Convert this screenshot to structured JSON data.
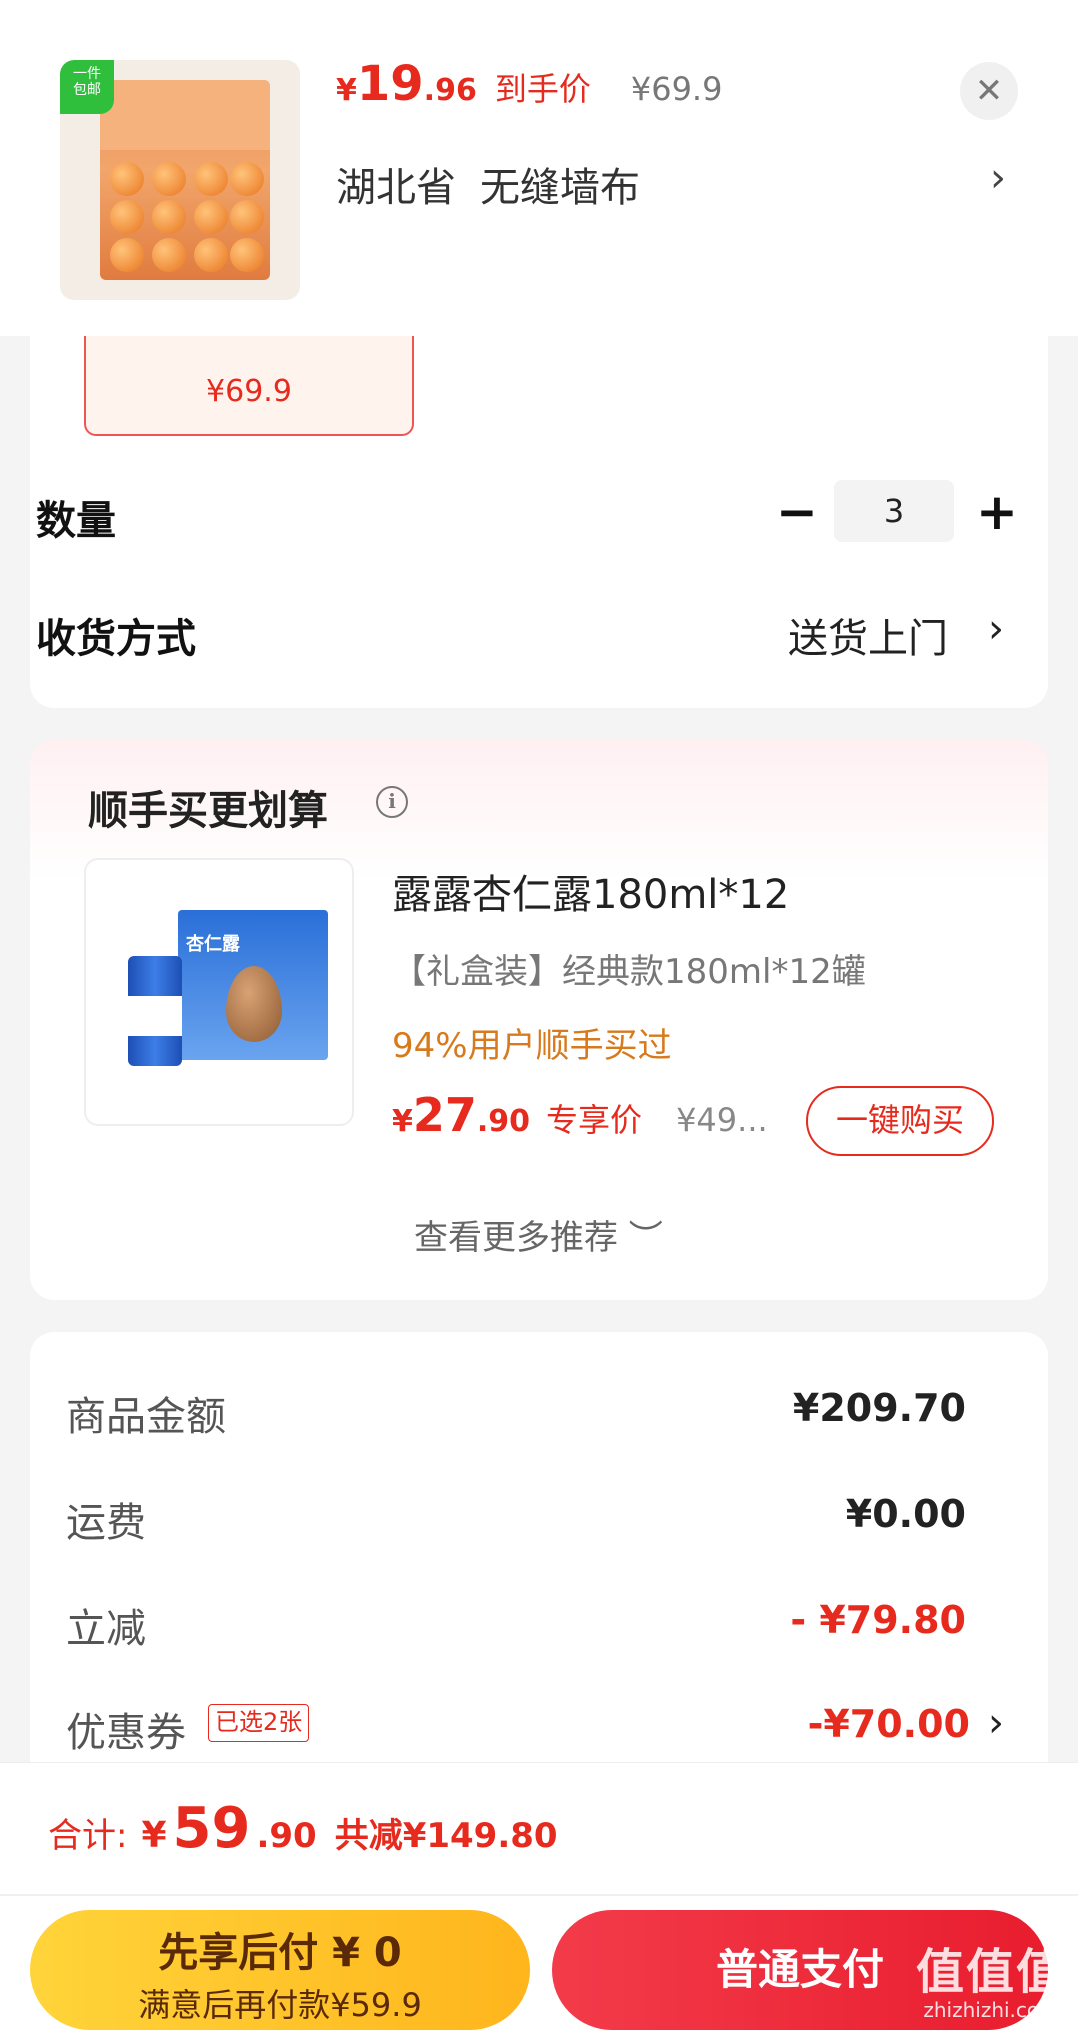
{
  "header": {
    "badge": "一件\n包邮",
    "price_symbol": "¥",
    "price_int": "19",
    "price_dec": ".96",
    "price_tag": "到手价",
    "orig_price": "¥69.9",
    "close": "✕",
    "address_region": "湖北省",
    "address_detail": "无缝墙布",
    "address_chevron": "›"
  },
  "spec": {
    "price": "¥69.9"
  },
  "quantity": {
    "label": "数量",
    "minus": "−",
    "value": "3",
    "plus": "+"
  },
  "shipping": {
    "label": "收货方式",
    "value": "送货上门",
    "chevron": "›"
  },
  "recommend": {
    "title": "顺手买更划算",
    "info": "i",
    "item": {
      "image_label": "杏仁露",
      "name": "露露杏仁露180ml*12",
      "spec": "【礼盒装】经典款180ml*12罐",
      "bought": "94%用户顺手买过",
      "price_symbol": "¥",
      "price_int": "27",
      "price_dec": ".90",
      "exclusive": "专享价",
      "orig_price": "¥49...",
      "buy_button": "一键购买"
    },
    "more": "查看更多推荐 ︶"
  },
  "summary": {
    "rows": [
      {
        "label": "商品金额",
        "value": "¥209.70"
      },
      {
        "label": "运费",
        "value": "¥0.00"
      },
      {
        "label": "立减",
        "value": "- ¥79.80"
      },
      {
        "label": "优惠券",
        "value": "-¥70.00"
      }
    ],
    "coupon_badge": "已选2张",
    "coupon_chevron": "›"
  },
  "total": {
    "label": "合计:",
    "symbol": "¥",
    "int": "59",
    "dec": ".90",
    "saved": "共减¥149.80"
  },
  "buttons": {
    "pay_later_line1": "先享后付 ¥ 0",
    "pay_later_line2": "满意后再付款¥59.9",
    "pay_normal": "普通支付"
  },
  "watermark": {
    "mark": "值值值",
    "domain": "zhizhizhi.com"
  },
  "colors": {
    "accent": "#e62b1e",
    "pay_later": "#ffc52a",
    "pay_normal": "#ec2435",
    "bought": "#d77a1e"
  }
}
